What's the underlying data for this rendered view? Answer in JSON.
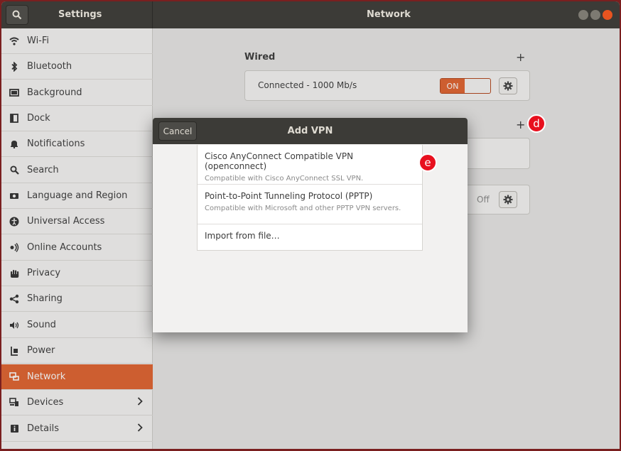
{
  "titlebar": {
    "left_title": "Settings",
    "main_title": "Network"
  },
  "sidebar": {
    "items": [
      {
        "label": "Wi-Fi",
        "icon": "wifi-icon"
      },
      {
        "label": "Bluetooth",
        "icon": "bluetooth-icon"
      },
      {
        "label": "Background",
        "icon": "background-icon"
      },
      {
        "label": "Dock",
        "icon": "dock-icon"
      },
      {
        "label": "Notifications",
        "icon": "bell-icon"
      },
      {
        "label": "Search",
        "icon": "search-icon"
      },
      {
        "label": "Language and Region",
        "icon": "camera-icon"
      },
      {
        "label": "Universal Access",
        "icon": "accessibility-icon"
      },
      {
        "label": "Online Accounts",
        "icon": "accounts-icon"
      },
      {
        "label": "Privacy",
        "icon": "hand-icon"
      },
      {
        "label": "Sharing",
        "icon": "share-icon"
      },
      {
        "label": "Sound",
        "icon": "speaker-icon"
      },
      {
        "label": "Power",
        "icon": "power-icon"
      },
      {
        "label": "Network",
        "icon": "network-icon",
        "active": true
      },
      {
        "label": "Devices",
        "icon": "devices-icon",
        "chevron": true
      },
      {
        "label": "Details",
        "icon": "info-icon",
        "chevron": true
      }
    ]
  },
  "network": {
    "wired_title": "Wired",
    "wired_status": "Connected - 1000 Mb/s",
    "wired_toggle": "ON",
    "proxy_toggle": "Off"
  },
  "dialog": {
    "cancel_label": "Cancel",
    "title": "Add VPN",
    "options": [
      {
        "name": "Cisco AnyConnect Compatible VPN (openconnect)",
        "desc": "Compatible with Cisco AnyConnect SSL VPN."
      },
      {
        "name": "Point-to-Point Tunneling Protocol (PPTP)",
        "desc": "Compatible with Microsoft and other PPTP VPN servers."
      },
      {
        "name": "Import from file…",
        "desc": ""
      }
    ]
  },
  "markers": {
    "d": "d",
    "e": "e"
  },
  "colors": {
    "accent": "#e2632f",
    "titlebar": "#3c3b37",
    "marker": "#e8101e"
  }
}
